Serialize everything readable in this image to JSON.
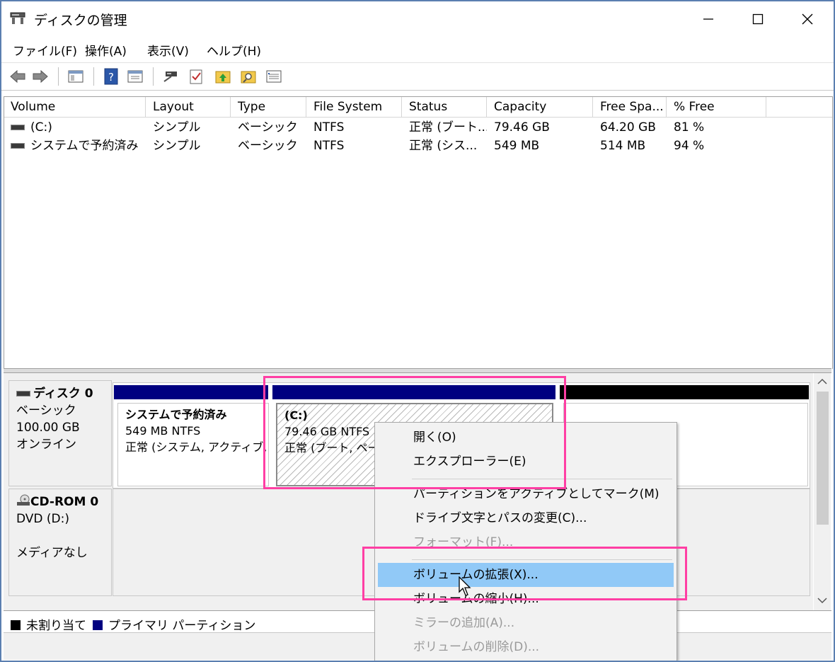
{
  "window": {
    "title": "ディスクの管理",
    "controls": {
      "minimize": "—",
      "maximize": "☐",
      "close": "✕"
    }
  },
  "menu": [
    "ファイル(F)",
    "操作(A)",
    "表示(V)",
    "ヘルプ(H)"
  ],
  "toolbar_icons": [
    "back-arrow-icon",
    "forward-arrow-icon",
    "console-tree-icon",
    "help-icon",
    "properties-icon",
    "connect-icon",
    "check-icon",
    "folder-up-icon",
    "folder-search-icon",
    "list-icon"
  ],
  "volume_list": {
    "columns": [
      "Volume",
      "Layout",
      "Type",
      "File System",
      "Status",
      "Capacity",
      "Free Spa...",
      "% Free"
    ],
    "rows": [
      [
        "(C:)",
        "シンプル",
        "ベーシック",
        "NTFS",
        "正常 (ブート...",
        "79.46 GB",
        "64.20 GB",
        "81 %"
      ],
      [
        "システムで予約済み",
        "シンプル",
        "ベーシック",
        "NTFS",
        "正常 (シス...",
        "549 MB",
        "514 MB",
        "94 %"
      ]
    ]
  },
  "disks": {
    "disk0": {
      "name": "ディスク 0",
      "type": "ベーシック",
      "size": "100.00 GB",
      "state": "オンライン",
      "partitions": [
        {
          "title": "システムで予約済み",
          "size": "549 MB NTFS",
          "status": "正常 (システム, アクティブ, プ"
        },
        {
          "title": "(C:)",
          "size": "79.46 GB NTFS",
          "status": "正常 (ブート, ページ"
        }
      ]
    },
    "cdrom0": {
      "name": "CD-ROM 0",
      "drive": "DVD (D:)",
      "media": "メディアなし"
    }
  },
  "legend": {
    "unallocated": "未割り当て",
    "primary": "プライマリ パーティション"
  },
  "context_menu": {
    "items": [
      {
        "label": "開く(O)",
        "enabled": true
      },
      {
        "label": "エクスプローラー(E)",
        "enabled": true
      },
      {
        "label": "パーティションをアクティブとしてマーク(M)",
        "enabled": true
      },
      {
        "label": "ドライブ文字とパスの変更(C)...",
        "enabled": true
      },
      {
        "label": "フォーマット(F)...",
        "enabled": false
      },
      {
        "label": "ボリュームの拡張(X)...",
        "enabled": true,
        "highlighted": true
      },
      {
        "label": "ボリュームの縮小(H)...",
        "enabled": true
      },
      {
        "label": "ミラーの追加(A)...",
        "enabled": false
      },
      {
        "label": "ボリュームの削除(D)...",
        "enabled": false
      }
    ]
  },
  "colors": {
    "primary_partition": "#000080",
    "unallocated": "#000000",
    "menu_highlight": "#91c9f7",
    "annotation": "#ff3fa4"
  }
}
